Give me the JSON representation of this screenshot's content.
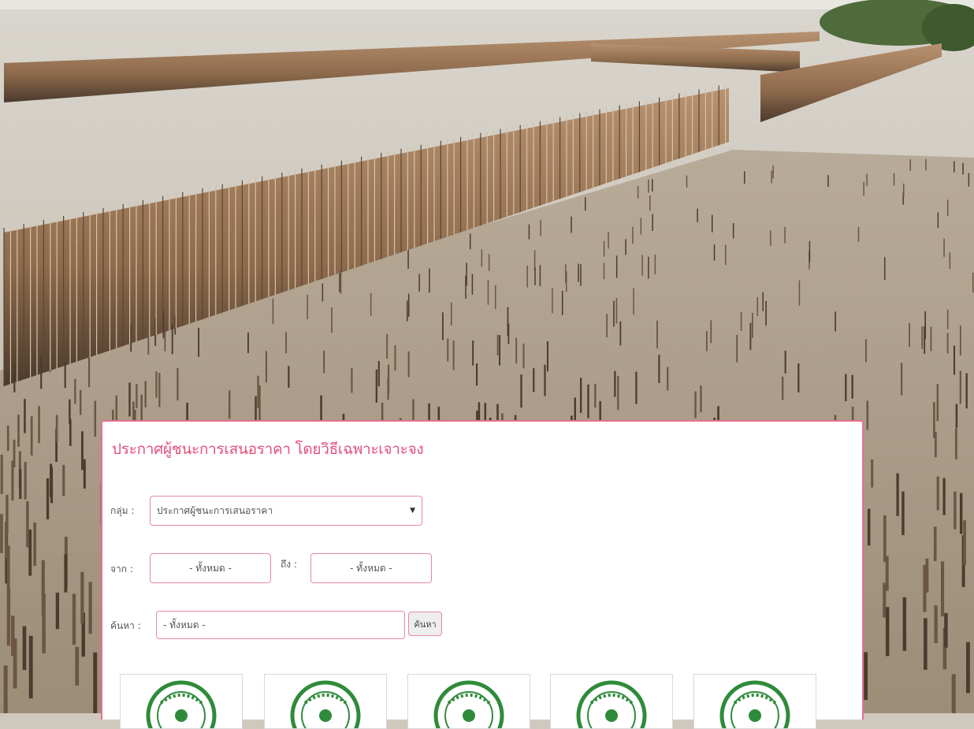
{
  "announcement": {
    "title": "ประกาศผู้ชนะการเสนอราคา โดยวิธีเฉพาะเจาะจง",
    "filters": {
      "group_label": "กลุ่ม :",
      "group_selected": "ประกาศผู้ชนะการเสนอราคา",
      "from_label": "จาก :",
      "from_value": "- ทั้งหมด -",
      "to_label": "ถึง :",
      "to_value": "- ทั้งหมด -",
      "search_label": "ค้นหา :",
      "search_placeholder": "- ทั้งหมด -",
      "search_button": "ค้นหา"
    },
    "cards": [
      {
        "icon": "agency-seal-logo"
      },
      {
        "icon": "agency-seal-logo"
      },
      {
        "icon": "agency-seal-logo"
      },
      {
        "icon": "agency-seal-logo"
      },
      {
        "icon": "agency-seal-logo"
      }
    ]
  },
  "colors": {
    "accent": "#e4507c",
    "field_border": "#e58aa4",
    "seal_green": "#2e8b3a"
  }
}
